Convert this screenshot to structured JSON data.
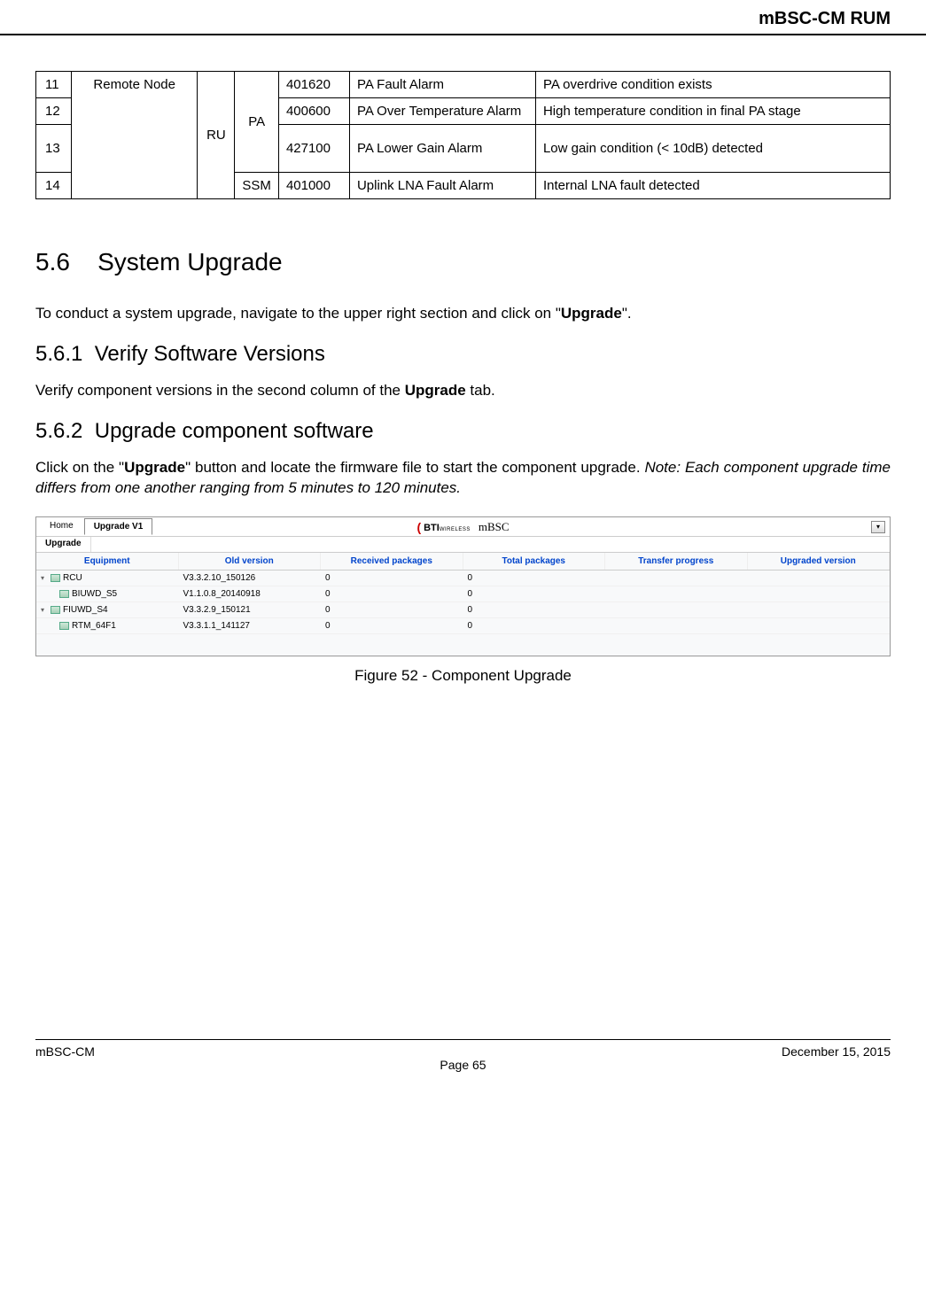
{
  "header": {
    "title": "mBSC-CM RUM"
  },
  "alarm_table": {
    "rows": [
      {
        "num": "11",
        "node": "Remote Node",
        "dev": "RU",
        "sub": "PA",
        "code": "401620",
        "name": "PA Fault Alarm",
        "desc": "PA overdrive condition exists"
      },
      {
        "num": "12",
        "node": "",
        "dev": "",
        "sub": "",
        "code": "400600",
        "name": "PA Over Temperature Alarm",
        "desc": "High temperature condition in final PA stage"
      },
      {
        "num": "13",
        "node": "",
        "dev": "",
        "sub": "",
        "code": "427100",
        "name": "PA Lower Gain Alarm",
        "desc": "Low gain condition (< 10dB) detected"
      },
      {
        "num": "14",
        "node": "",
        "dev": "",
        "sub": "SSM",
        "code": "401000",
        "name": "Uplink LNA Fault Alarm",
        "desc": "Internal LNA fault detected"
      }
    ]
  },
  "section_5_6": {
    "number": "5.6",
    "title": "System Upgrade",
    "intro_prefix": "To conduct a system upgrade, navigate to the upper right section and click on \"",
    "intro_bold": "Upgrade",
    "intro_suffix": "\"."
  },
  "section_5_6_1": {
    "number": "5.6.1",
    "title": "Verify Software Versions",
    "text_prefix": "Verify component versions in the second column of the ",
    "text_bold": "Upgrade",
    "text_suffix": " tab."
  },
  "section_5_6_2": {
    "number": "5.6.2",
    "title": "Upgrade component software",
    "text_prefix": "Click on the \"",
    "text_bold": "Upgrade",
    "text_mid": "\" button and locate the firmware file to start the component upgrade. ",
    "text_note": "Note: Each component upgrade time differs from one another ranging from 5 minutes to 120 minutes."
  },
  "screenshot": {
    "top_tabs": {
      "home": "Home",
      "upgrade": "Upgrade V1"
    },
    "logo": {
      "bti": "BTI",
      "wireless": "WIRELESS",
      "mbsc": "mBSC"
    },
    "sub_tab": "Upgrade",
    "columns": [
      "Equipment",
      "Old version",
      "Received packages",
      "Total packages",
      "Transfer progress",
      "Upgraded version"
    ],
    "rows": [
      {
        "name": "RCU",
        "indent": false,
        "expand": "▾",
        "ver": "V3.3.2.10_150126",
        "recv": "0",
        "total": "0"
      },
      {
        "name": "BIUWD_S5",
        "indent": true,
        "expand": "",
        "ver": "V1.1.0.8_20140918",
        "recv": "0",
        "total": "0"
      },
      {
        "name": "FIUWD_S4",
        "indent": false,
        "expand": "▾",
        "ver": "V3.3.2.9_150121",
        "recv": "0",
        "total": "0"
      },
      {
        "name": "RTM_64F1",
        "indent": true,
        "expand": "",
        "ver": "V3.3.1.1_141127",
        "recv": "0",
        "total": "0"
      }
    ]
  },
  "figure_caption": "Figure 52 - Component Upgrade",
  "footer": {
    "left": "mBSC-CM",
    "right": "December 15, 2015",
    "center": "Page 65"
  }
}
